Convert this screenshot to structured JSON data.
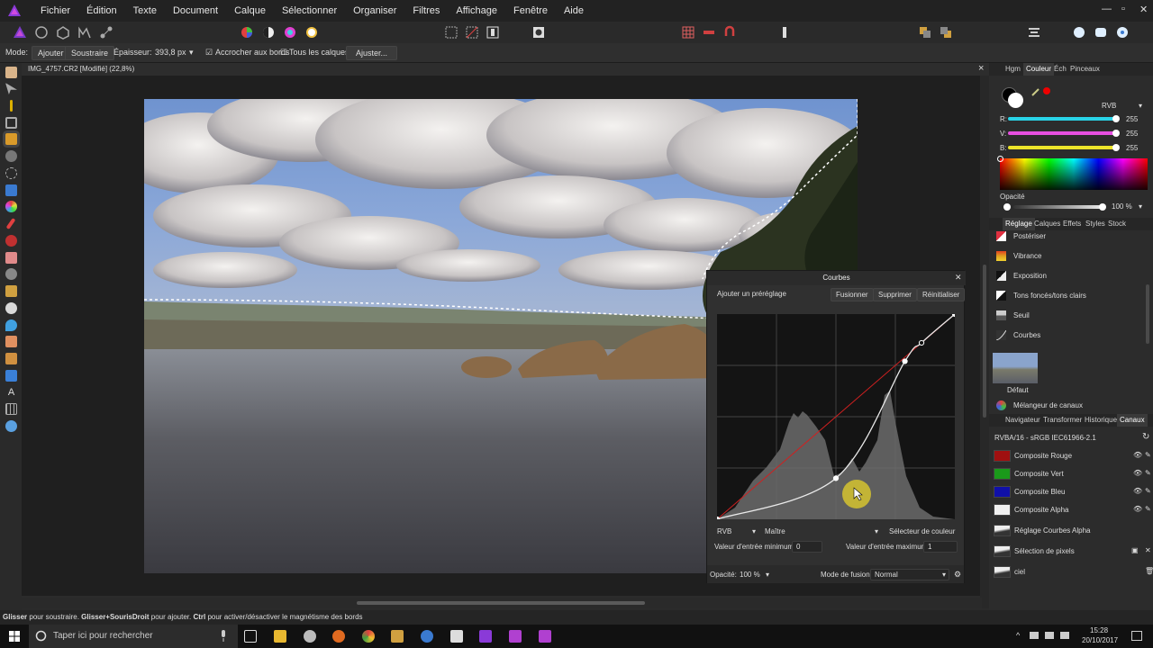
{
  "menubar": {
    "items": [
      "Fichier",
      "Édition",
      "Texte",
      "Document",
      "Calque",
      "Sélectionner",
      "Organiser",
      "Filtres",
      "Affichage",
      "Fenêtre",
      "Aide"
    ],
    "min_glyph": "—",
    "max_glyph": "▫",
    "close_glyph": "✕"
  },
  "context_bar": {
    "mode_label": "Mode:",
    "add_label": "Ajouter",
    "subtract_label": "Soustraire",
    "thickness_label": "Épaisseur:",
    "thickness_value": "393,8 px",
    "snap_edges_label": "Accrocher aux bords",
    "snap_edges_checked": true,
    "all_layers_label": "Tous les calques",
    "all_layers_checked": false,
    "refine_label": "Ajuster..."
  },
  "document": {
    "tab_title": "IMG_4757.CR2 [Modifié] (22,8%)",
    "close_glyph": "×"
  },
  "curves": {
    "title": "Courbes",
    "add_preset": "Ajouter un préréglage",
    "merge": "Fusionner",
    "delete": "Supprimer",
    "reset": "Réinitialiser",
    "color_space": "RVB",
    "channel": "Maître",
    "color_picker": "Sélecteur de couleur",
    "min_input_label": "Valeur d'entrée minimum:",
    "min_input_value": "0",
    "max_input_label": "Valeur d'entrée maximum:",
    "max_input_value": "1",
    "opacity_label": "Opacité:",
    "opacity_value": "100 %",
    "blend_label": "Mode de fusion:",
    "blend_value": "Normal",
    "close_glyph": "✕"
  },
  "color_panel": {
    "tabs": [
      "Hgm",
      "Couleur",
      "Éch",
      "Pinceaux"
    ],
    "active_tab": "Couleur",
    "model": "RVB",
    "channels": [
      {
        "label": "R:",
        "value": "255",
        "color": "#29d4e8"
      },
      {
        "label": "V:",
        "value": "255",
        "color": "#e64fe0"
      },
      {
        "label": "B:",
        "value": "255",
        "color": "#ece42a"
      }
    ],
    "opacity_label": "Opacité",
    "opacity_value": "100 %"
  },
  "adjust_panel": {
    "tabs": [
      "Réglage",
      "Calques",
      "Effets",
      "Styles",
      "Stock"
    ],
    "active_tab": "Réglage",
    "items": [
      {
        "label": "Postériser",
        "icon": "posterize-icon"
      },
      {
        "label": "Vibrance",
        "icon": "vibrance-icon"
      },
      {
        "label": "Exposition",
        "icon": "exposure-icon"
      },
      {
        "label": "Tons foncés/tons clairs",
        "icon": "shadows-highlights-icon"
      },
      {
        "label": "Seuil",
        "icon": "threshold-icon"
      },
      {
        "label": "Courbes",
        "icon": "curves-icon"
      }
    ],
    "preset_label": "Défaut",
    "channel_mixer": "Mélangeur de canaux"
  },
  "channels_panel": {
    "tabs": [
      "Navigateur",
      "Transformer",
      "Historique",
      "Canaux"
    ],
    "active_tab": "Canaux",
    "profile": "RVBA/16 - sRGB IEC61966-2.1",
    "channels": [
      {
        "label": "Composite Rouge",
        "color": "#a01010"
      },
      {
        "label": "Composite Vert",
        "color": "#1a9a1a"
      },
      {
        "label": "Composite Bleu",
        "color": "#1010a8"
      },
      {
        "label": "Composite Alpha",
        "color": "#f0f0f0"
      }
    ],
    "extra": [
      "Réglage Courbes Alpha",
      "Sélection de pixels",
      "ciel"
    ]
  },
  "statusbar": {
    "k1": "Glisser",
    "t1": " pour soustraire. ",
    "k2": "Glisser+SourisDroit",
    "t2": " pour ajouter. ",
    "k3": "Ctrl",
    "t3": " pour activer/désactiver le magnétisme des bords"
  },
  "taskbar": {
    "search_placeholder": "Taper ici pour rechercher",
    "time": "15:28",
    "date": "20/10/2017"
  },
  "chart_data": {
    "type": "line",
    "xlim": [
      0,
      1
    ],
    "ylim": [
      0,
      1
    ],
    "series": [
      {
        "values": [
          [
            0,
            0
          ],
          [
            0.5,
            0.5
          ],
          [
            1,
            1
          ]
        ]
      },
      {
        "values": [
          [
            0,
            0
          ],
          [
            0.5,
            0.2
          ],
          [
            0.79,
            0.77
          ],
          [
            0.86,
            0.86
          ],
          [
            1,
            1
          ]
        ]
      }
    ]
  }
}
